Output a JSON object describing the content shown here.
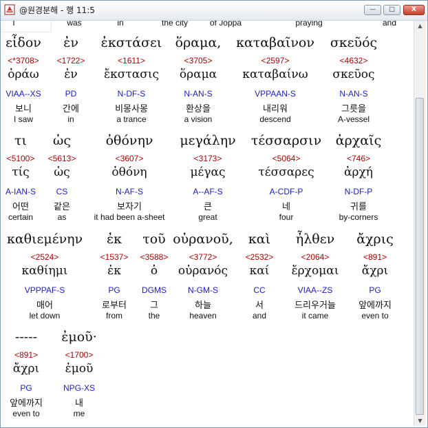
{
  "window": {
    "title": "@원경분해 - 행 11:5",
    "min_glyph": "—",
    "max_glyph": "□",
    "close_glyph": "X"
  },
  "top_strip": [
    "I",
    "was",
    "in",
    "the city",
    "of Joppa",
    "praying",
    "and"
  ],
  "rows": [
    {
      "words": [
        {
          "greek": "εἶδον",
          "strong": "<*3708>",
          "lemma": "ὁράω",
          "parse": "VIAA--XS",
          "korean": "보니",
          "english": "I saw"
        },
        {
          "greek": "ἐν",
          "strong": "<1722>",
          "lemma": "ἐν",
          "parse": "PD",
          "korean": "간에",
          "english": "in"
        },
        {
          "greek": "ἐκστάσει",
          "strong": "<1611>",
          "lemma": "ἔκστασις",
          "parse": "N-DF-S",
          "korean": "비몽사몽",
          "english": "a trance"
        },
        {
          "greek": "ὅραμα,",
          "strong": "<3705>",
          "lemma": "ὅραμα",
          "parse": "N-AN-S",
          "korean": "환상을",
          "english": "a vision"
        },
        {
          "greek": "καταβαῖνον",
          "strong": "<2597>",
          "lemma": "καταβαίνω",
          "parse": "VPPAAN-S",
          "korean": "내리워",
          "english": "descend"
        },
        {
          "greek": "σκεῦός",
          "strong": "<4632>",
          "lemma": "σκεῦος",
          "parse": "N-AN-S",
          "korean": "그릇을",
          "english": "A-vessel"
        }
      ]
    },
    {
      "words": [
        {
          "greek": "τι",
          "strong": "<5100>",
          "lemma": "τίς",
          "parse": "A-IAN-S",
          "korean": "어떤",
          "english": "certain"
        },
        {
          "greek": "ὡς",
          "strong": "<5613>",
          "lemma": "ὡς",
          "parse": "CS",
          "korean": "같은",
          "english": "as"
        },
        {
          "greek": "ὀθόνην",
          "strong": "<3607>",
          "lemma": "ὀθόνη",
          "parse": "N-AF-S",
          "korean": "보자기",
          "english": "it had been a-sheet"
        },
        {
          "greek": "μεγάλην",
          "strong": "<3173>",
          "lemma": "μέγας",
          "parse": "A--AF-S",
          "korean": "큰",
          "english": "great"
        },
        {
          "greek": "τέσσαρσιν",
          "strong": "<5064>",
          "lemma": "τέσσαρες",
          "parse": "A-CDF-P",
          "korean": "네",
          "english": "four"
        },
        {
          "greek": "ἀρχαῖς",
          "strong": "<746>",
          "lemma": "ἀρχή",
          "parse": "N-DF-P",
          "korean": "귀를",
          "english": "by-corners"
        }
      ]
    },
    {
      "words": [
        {
          "greek": "καθιεμένην",
          "strong": "<2524>",
          "lemma": "καθίημι",
          "parse": "VPPPAF-S",
          "korean": "매어",
          "english": "let down"
        },
        {
          "greek": "ἐκ",
          "strong": "<1537>",
          "lemma": "ἐκ",
          "parse": "PG",
          "korean": "로부터",
          "english": "from"
        },
        {
          "greek": "τοῦ",
          "strong": "<3588>",
          "lemma": "ὁ",
          "parse": "DGMS",
          "korean": "그",
          "english": "the"
        },
        {
          "greek": "οὐρανοῦ,",
          "strong": "<3772>",
          "lemma": "οὐρανός",
          "parse": "N-GM-S",
          "korean": "하늘",
          "english": "heaven"
        },
        {
          "greek": "καὶ",
          "strong": "<2532>",
          "lemma": "καί",
          "parse": "CC",
          "korean": "서",
          "english": "and"
        },
        {
          "greek": "ἦλθεν",
          "strong": "<2064>",
          "lemma": "ἔρχομαι",
          "parse": "VIAA--ZS",
          "korean": "드리우거늘",
          "english": "it came"
        },
        {
          "greek": "ἄχρις",
          "strong": "<891>",
          "lemma": "ἄχρι",
          "parse": "PG",
          "korean": "앞에까지",
          "english": "even to"
        }
      ]
    },
    {
      "words": [
        {
          "greek": "-----",
          "strong": "<891>",
          "lemma": "ἄχρι",
          "parse": "PG",
          "korean": "앞에까지",
          "english": "even to"
        },
        {
          "greek": "ἐμοῦ·",
          "strong": "<1700>",
          "lemma": "ἐμοῦ",
          "parse": "NPG-XS",
          "korean": "내",
          "english": "me"
        }
      ]
    }
  ]
}
